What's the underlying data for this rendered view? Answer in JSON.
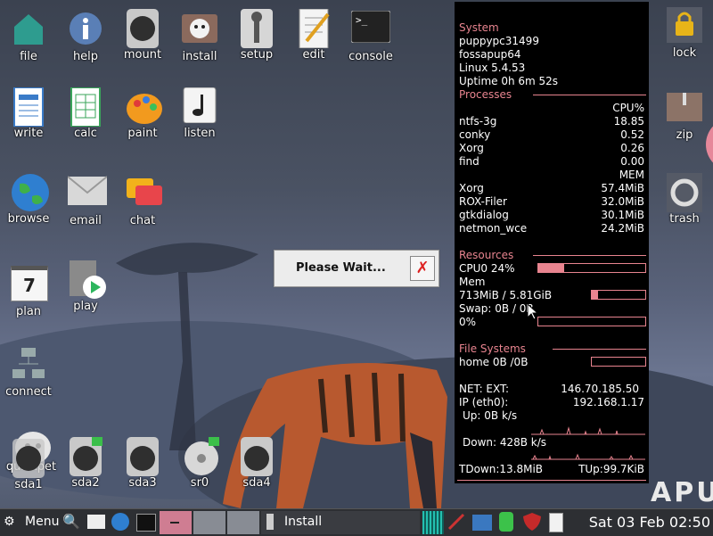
{
  "desktop": {
    "icons": [
      {
        "label": "file"
      },
      {
        "label": "help"
      },
      {
        "label": "mount"
      },
      {
        "label": "install"
      },
      {
        "label": "setup"
      },
      {
        "label": "edit"
      },
      {
        "label": "console"
      },
      {
        "label": "write"
      },
      {
        "label": "calc"
      },
      {
        "label": "paint"
      },
      {
        "label": "listen"
      },
      {
        "label": "browse"
      },
      {
        "label": "email"
      },
      {
        "label": "chat"
      },
      {
        "label": "plan"
      },
      {
        "label": "play"
      },
      {
        "label": "connect"
      },
      {
        "label": "quickpet"
      },
      {
        "label": "sda1"
      },
      {
        "label": "sda2"
      },
      {
        "label": "sda3"
      },
      {
        "label": "sr0"
      },
      {
        "label": "sda4"
      },
      {
        "label": "lock"
      },
      {
        "label": "zip"
      },
      {
        "label": "trash"
      }
    ],
    "plan_day": "7",
    "wallpaper_text": "APU"
  },
  "dialog": {
    "message": "Please Wait...",
    "close_glyph": "✗"
  },
  "conky": {
    "system_header": "System",
    "hostname": "puppypc31499",
    "distro": "fossapup64",
    "kernel": "Linux 5.4.53",
    "uptime": "Uptime 0h 6m 52s",
    "processes_header": "Processes",
    "cpu_col": "CPU%",
    "cpu_procs": [
      {
        "name": "ntfs-3g",
        "value": "18.85"
      },
      {
        "name": "conky",
        "value": "0.52"
      },
      {
        "name": "Xorg",
        "value": "0.26"
      },
      {
        "name": "find",
        "value": "0.00"
      }
    ],
    "mem_col": "MEM",
    "mem_procs": [
      {
        "name": "Xorg",
        "value": "57.4MiB"
      },
      {
        "name": "ROX-Filer",
        "value": "32.0MiB"
      },
      {
        "name": "gtkdialog",
        "value": "30.1MiB"
      },
      {
        "name": "netmon_wce",
        "value": "24.2MiB"
      }
    ],
    "resources_header": "Resources",
    "cpu0_label": "CPU0 24%",
    "cpu0_percent": 24,
    "mem_label": "Mem",
    "mem_value": "713MiB / 5.81GiB",
    "mem_percent": 12,
    "swap_label": "Swap: 0B   / 0B",
    "swap_pct_label": "0%",
    "swap_percent": 0,
    "fs_header": "File Systems",
    "home_fs": "home 0B  /0B",
    "home_percent": 0,
    "net_ext_label": "NET: EXT:",
    "net_ext_ip": "146.70.185.50",
    "ip_label": "IP (eth0):",
    "ip_value": "192.168.1.17",
    "up_label": "Up: 0B   k/s",
    "down_label": "Down: 428B  k/s",
    "tdown": "TDown:13.8MiB",
    "tup": "TUp:99.7KiB",
    "accent": "#e8848f"
  },
  "taskbar": {
    "menu_label": "Menu",
    "task_label": "Install",
    "clock": "Sat 03 Feb 02:50"
  }
}
